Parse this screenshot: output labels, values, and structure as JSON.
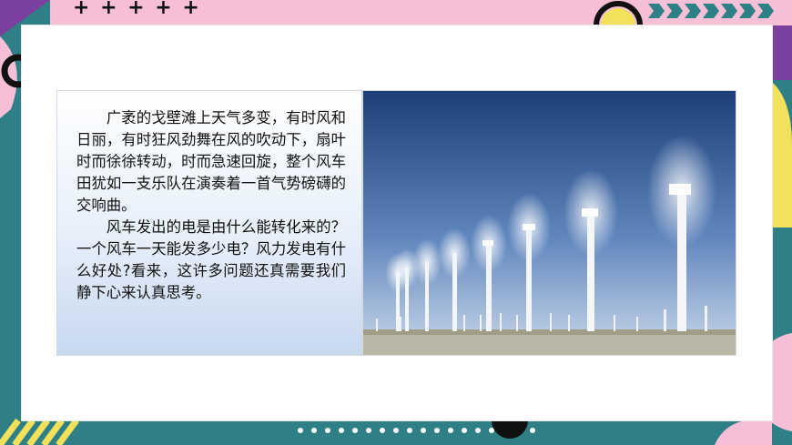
{
  "content": {
    "paragraphs": [
      "广袤的戈壁滩上天气多变，有时风和日丽，有时狂风劲舞在风的吹动下，扇叶时而徐徐转动，时而急速回旋，整个风车田犹如一支乐队在演奏着一首气势磅礴的交响曲。",
      "风车发出的电是由什么能转化来的？一个风车一天能发多少电？风力发电有什么好处?看来，这许多问题还真需要我们静下心来认真思考。"
    ]
  },
  "image": {
    "subject": "wind-turbines"
  },
  "decor": {
    "plus_marks": "+ + + + +"
  },
  "colors": {
    "background": "#2f7f86",
    "pink": "#f6bfd6",
    "purple": "#7b3fa0",
    "yellow": "#f2e15a",
    "sky_top": "#1c3f7a",
    "sky_bottom": "#cfdbeb"
  }
}
